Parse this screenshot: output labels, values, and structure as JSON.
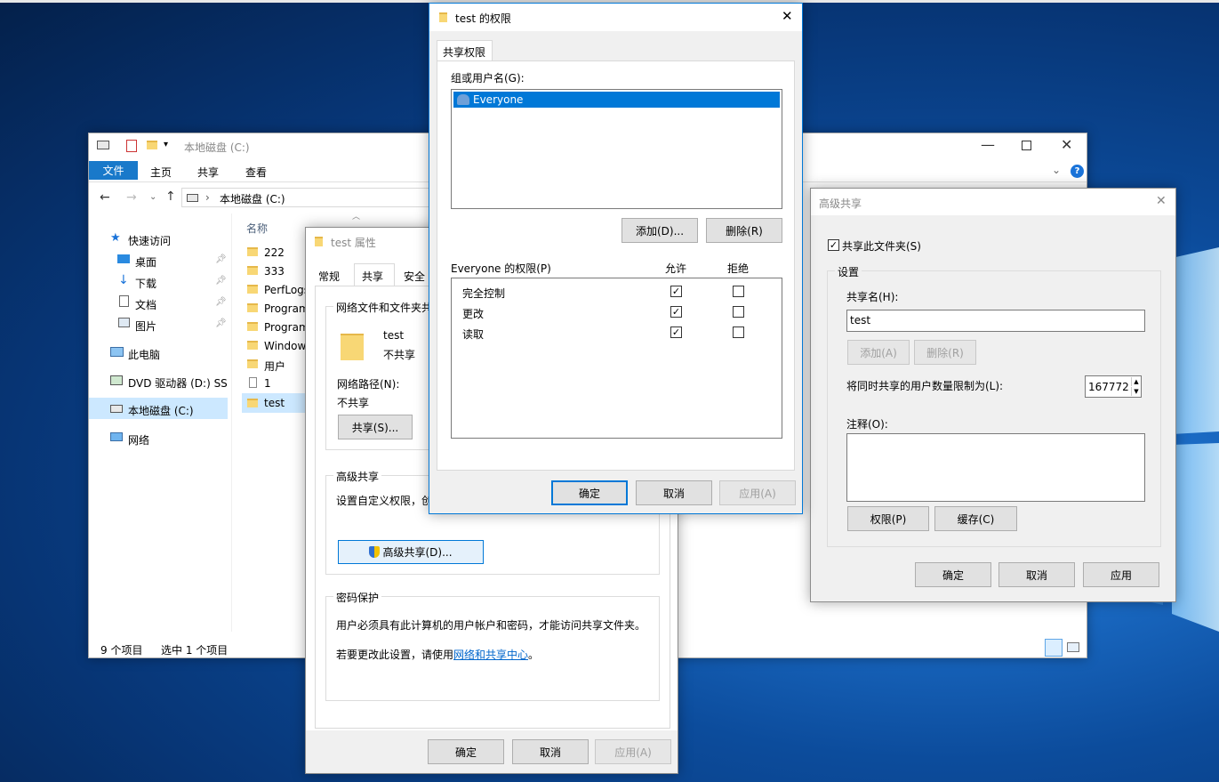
{
  "explorer": {
    "title": "本地磁盘 (C:)",
    "ribbon_tabs": [
      "文件",
      "主页",
      "共享",
      "查看"
    ],
    "address": "本地磁盘 (C:)",
    "column_name": "名称",
    "nav": {
      "quick_access": "快速访问",
      "pinned": [
        "桌面",
        "下载",
        "文档",
        "图片"
      ],
      "this_pc": "此电脑",
      "dvd": "DVD 驱动器 (D:) SSS",
      "local_disk": "本地磁盘 (C:)",
      "network": "网络"
    },
    "files": [
      "222",
      "333",
      "PerfLogs",
      "Program",
      "Program",
      "Window",
      "用户",
      "1",
      "test"
    ],
    "status_items": "9 个项目",
    "status_selected": "选中 1 个项目"
  },
  "properties": {
    "title": "test 属性",
    "tabs": [
      "常规",
      "共享",
      "安全"
    ],
    "network_group": "网络文件和文件夹共享",
    "folder_name": "test",
    "folder_state": "不共享",
    "network_path_label": "网络路径(N):",
    "network_path_value": "不共享",
    "share_button": "共享(S)...",
    "advanced_group": "高级共享",
    "advanced_desc": "设置自定义权限，创",
    "advanced_button": "高级共享(D)...",
    "password_group": "密码保护",
    "password_desc": "用户必须具有此计算机的用户帐户和密码，才能访问共享文件夹。",
    "password_change_prefix": "若要更改此设置，请使用",
    "password_link": "网络和共享中心",
    "password_change_suffix": "。",
    "ok": "确定",
    "cancel": "取消",
    "apply": "应用(A)"
  },
  "permissions": {
    "title": "test 的权限",
    "tab": "共享权限",
    "group_label": "组或用户名(G):",
    "users": [
      "Everyone"
    ],
    "add": "添加(D)...",
    "remove": "删除(R)",
    "perm_label": "Everyone 的权限(P)",
    "allow": "允许",
    "deny": "拒绝",
    "rows": [
      {
        "name": "完全控制",
        "allow": "✓",
        "deny": ""
      },
      {
        "name": "更改",
        "allow": "✓",
        "deny": ""
      },
      {
        "name": "读取",
        "allow": "✓",
        "deny": ""
      }
    ],
    "ok": "确定",
    "cancel": "取消",
    "apply": "应用(A)"
  },
  "advanced": {
    "title": "高级共享",
    "share_check_label": "共享此文件夹(S)",
    "share_checked": "✓",
    "settings_group": "设置",
    "share_name_label": "共享名(H):",
    "share_name_value": "test",
    "add": "添加(A)",
    "remove": "删除(R)",
    "limit_label": "将同时共享的用户数量限制为(L):",
    "limit_value": "167772",
    "comment_label": "注释(O):",
    "comment_value": "",
    "permissions_button": "权限(P)",
    "cache_button": "缓存(C)",
    "ok": "确定",
    "cancel": "取消",
    "apply": "应用"
  },
  "colors": {
    "accent": "#0078d7",
    "selection": "#0078d7",
    "nav_selected": "#cce8ff",
    "folder": "#f8d775",
    "link": "#0066cc"
  }
}
